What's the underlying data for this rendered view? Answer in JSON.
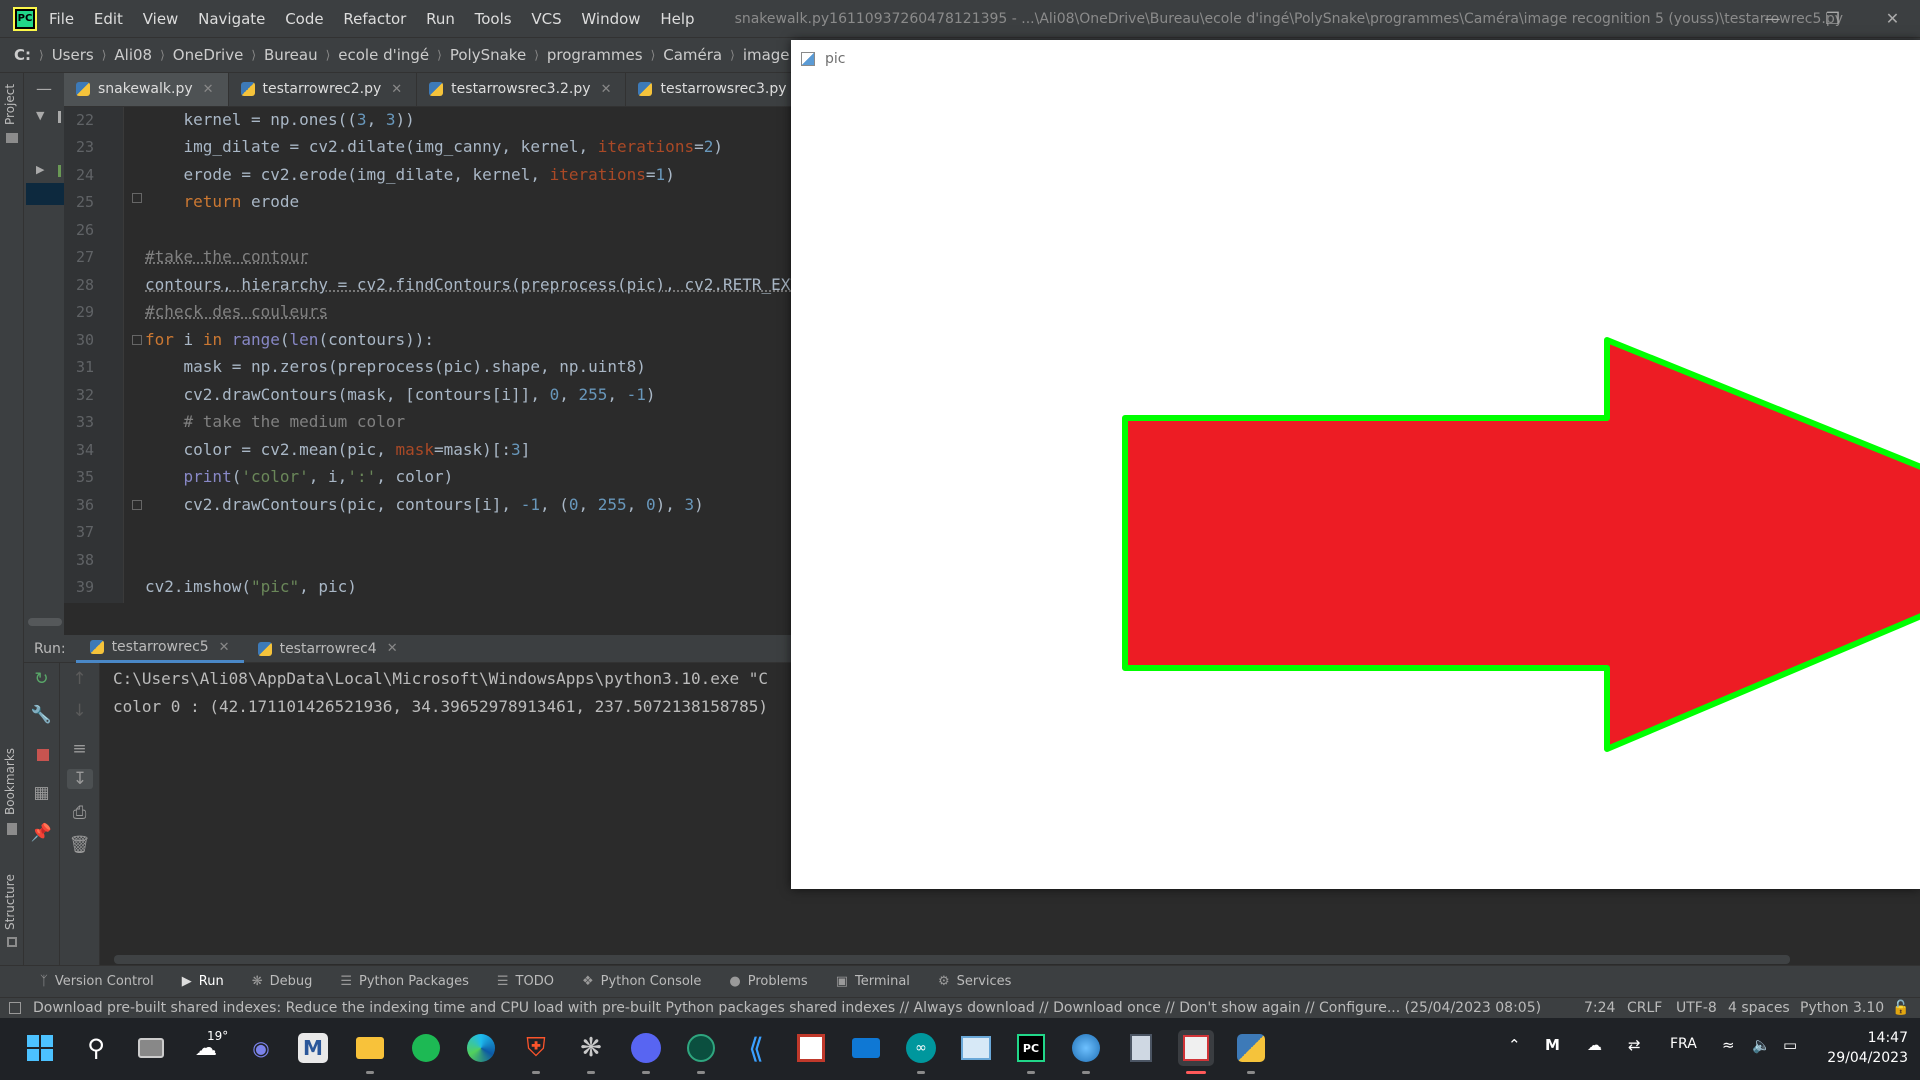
{
  "titlebar": {
    "menu": [
      "File",
      "Edit",
      "View",
      "Navigate",
      "Code",
      "Refactor",
      "Run",
      "Tools",
      "VCS",
      "Window",
      "Help"
    ],
    "title": "snakewalk.py16110937260478121395 - ...\\Ali08\\OneDrive\\Bureau\\ecole d'ingé\\PolySnake\\programmes\\Caméra\\image recognition 5 (youss)\\testarrowrec5.py"
  },
  "breadcrumb": [
    "C:",
    "Users",
    "Ali08",
    "OneDrive",
    "Bureau",
    "ecole d'ingé",
    "PolySnake",
    "programmes",
    "Caméra",
    "image recogniti"
  ],
  "side_labels": {
    "project": "Project",
    "bookmarks": "Bookmarks",
    "structure": "Structure"
  },
  "editor_tabs": [
    "snakewalk.py",
    "testarrowrec2.py",
    "testarrowsrec3.2.py",
    "testarrowsrec3.py"
  ],
  "editor": {
    "line_numbers": [
      "22",
      "23",
      "24",
      "25",
      "26",
      "27",
      "28",
      "29",
      "30",
      "31",
      "32",
      "33",
      "34",
      "35",
      "36",
      "37",
      "38",
      "39"
    ]
  },
  "run": {
    "label": "Run:",
    "tabs": [
      "testarrowrec5",
      "testarrowrec4"
    ],
    "console": [
      "C:\\Users\\Ali08\\AppData\\Local\\Microsoft\\WindowsApps\\python3.10.exe \"C",
      "color 0 : (42.171101426521936, 34.39652978913461, 237.5072138158785)"
    ]
  },
  "pic_window": {
    "title": "pic",
    "arrow_fill": "#ed1c24",
    "arrow_outline": "#00ff00"
  },
  "bottom_tools": [
    "Version Control",
    "Run",
    "Debug",
    "Python Packages",
    "TODO",
    "Python Console",
    "Problems",
    "Terminal",
    "Services"
  ],
  "status": {
    "message": "Download pre-built shared indexes: Reduce the indexing time and CPU load with pre-built Python packages shared indexes // Always download // Download once // Don't show again // Configure... (25/04/2023 08:05)",
    "position": "7:24",
    "line_sep": "CRLF",
    "encoding": "UTF-8",
    "indent": "4 spaces",
    "interpreter": "Python 3.10"
  },
  "taskbar": {
    "weather": "19°",
    "lang": "FRA",
    "time": "14:47",
    "date": "29/04/2023"
  }
}
